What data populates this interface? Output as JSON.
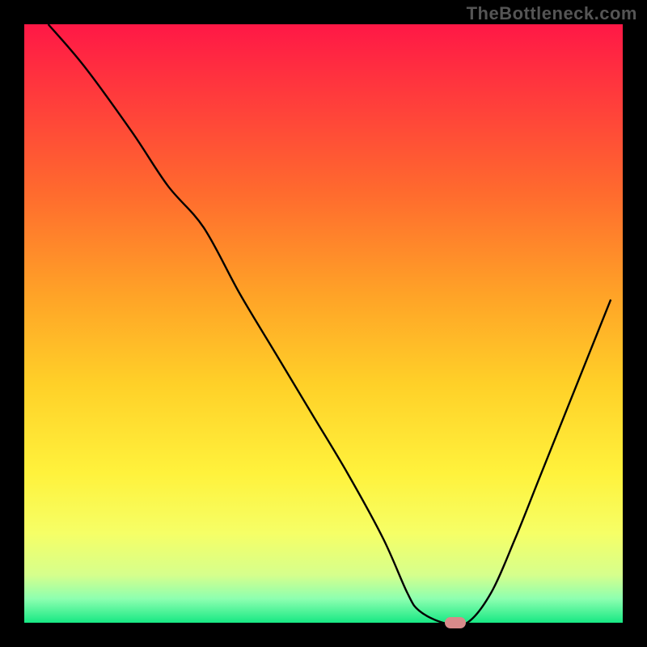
{
  "watermark": "TheBottleneck.com",
  "chart_data": {
    "type": "line",
    "title": "",
    "xlabel": "",
    "ylabel": "",
    "xlim": [
      0,
      100
    ],
    "ylim": [
      0,
      100
    ],
    "series": [
      {
        "name": "curve",
        "x": [
          4,
          10,
          18,
          24,
          30,
          36,
          42,
          48,
          54,
          60,
          64,
          66,
          70,
          74,
          78,
          82,
          86,
          90,
          94,
          98
        ],
        "y": [
          100,
          93,
          82,
          73,
          66,
          55,
          45,
          35,
          25,
          14,
          5,
          2,
          0,
          0,
          5,
          14,
          24,
          34,
          44,
          54
        ]
      }
    ],
    "marker": {
      "x": 72,
      "y": 0
    },
    "background_gradient": {
      "stops": [
        {
          "pos": 0.0,
          "color": "#ff1846"
        },
        {
          "pos": 0.12,
          "color": "#ff3b3c"
        },
        {
          "pos": 0.28,
          "color": "#ff6a2e"
        },
        {
          "pos": 0.45,
          "color": "#ffa227"
        },
        {
          "pos": 0.6,
          "color": "#ffd028"
        },
        {
          "pos": 0.75,
          "color": "#fff23c"
        },
        {
          "pos": 0.85,
          "color": "#f6ff66"
        },
        {
          "pos": 0.92,
          "color": "#d6ff8c"
        },
        {
          "pos": 0.96,
          "color": "#8dffb0"
        },
        {
          "pos": 1.0,
          "color": "#17e884"
        }
      ]
    }
  }
}
